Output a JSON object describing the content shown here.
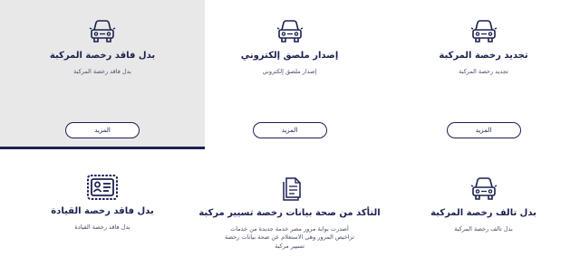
{
  "services": [
    {
      "id": "renew-license",
      "title": "تجديد رخصة المركبة",
      "description": "تجديد رخصة المركبة",
      "more_label": "المزيد",
      "icon": "car-icon"
    },
    {
      "id": "electronic-sticker",
      "title": "إصدار ملصق إلكتروني",
      "description": "إصدار ملصق إلكتروني",
      "more_label": "المزيد",
      "icon": "car-icon"
    },
    {
      "id": "lost-license",
      "title": "بدل فاقد رخصة المركبة",
      "description": "بدل فاقد رخصة المركبة",
      "more_label": "المزيد",
      "icon": "car-icon",
      "active": true
    },
    {
      "id": "damaged-license",
      "title": "بدل تالف رخصة المركبة",
      "description": "بدل تالف رخصة المركبة",
      "icon": "car-icon"
    },
    {
      "id": "verify-license",
      "title": "التأكد من صحة بيانات رخصة تسيير مركبة",
      "description": "أصدرت بوابة مرور مصر خدمة جديدة من خدمات تراخيص المرور وهى الاستعلام عن صحة بيانات رخصة تسيير مركبة",
      "icon": "document-icon"
    },
    {
      "id": "lost-driving-license",
      "title": "بدل فاقد رخصة القيادة",
      "description": "بدل فاقد رخصة القيادة",
      "icon": "id-card-icon"
    }
  ]
}
